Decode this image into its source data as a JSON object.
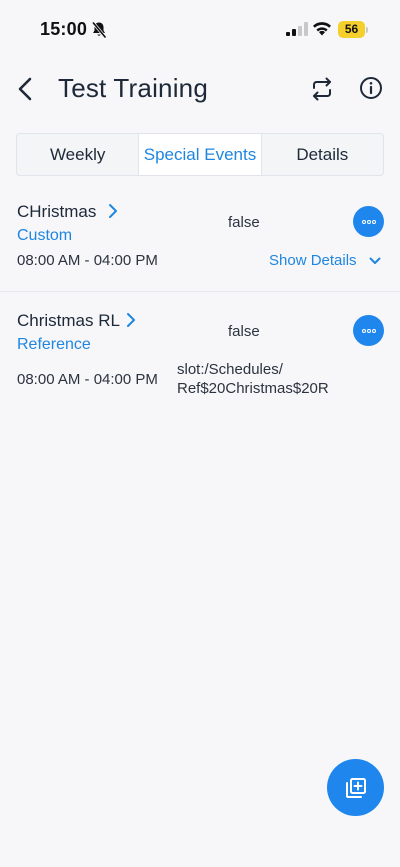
{
  "status_bar": {
    "time": "15:00",
    "battery": "56"
  },
  "header": {
    "title": "Test Training"
  },
  "tabs": [
    {
      "label": "Weekly"
    },
    {
      "label": "Special Events"
    },
    {
      "label": "Details"
    }
  ],
  "events": [
    {
      "name": "CHristmas",
      "type": "Custom",
      "value": "false",
      "time": "08:00 AM - 04:00 PM",
      "show_details": "Show Details"
    },
    {
      "name": "Christmas RL",
      "type": "Reference",
      "value": "false",
      "time": "08:00 AM - 04:00 PM",
      "path_line1": "slot:/Schedules/",
      "path_line2": "Ref$20Christmas$20R"
    }
  ],
  "colors": {
    "accent": "#1f86ee",
    "background": "#f7f7f9",
    "battery": "#f5cf2b"
  }
}
